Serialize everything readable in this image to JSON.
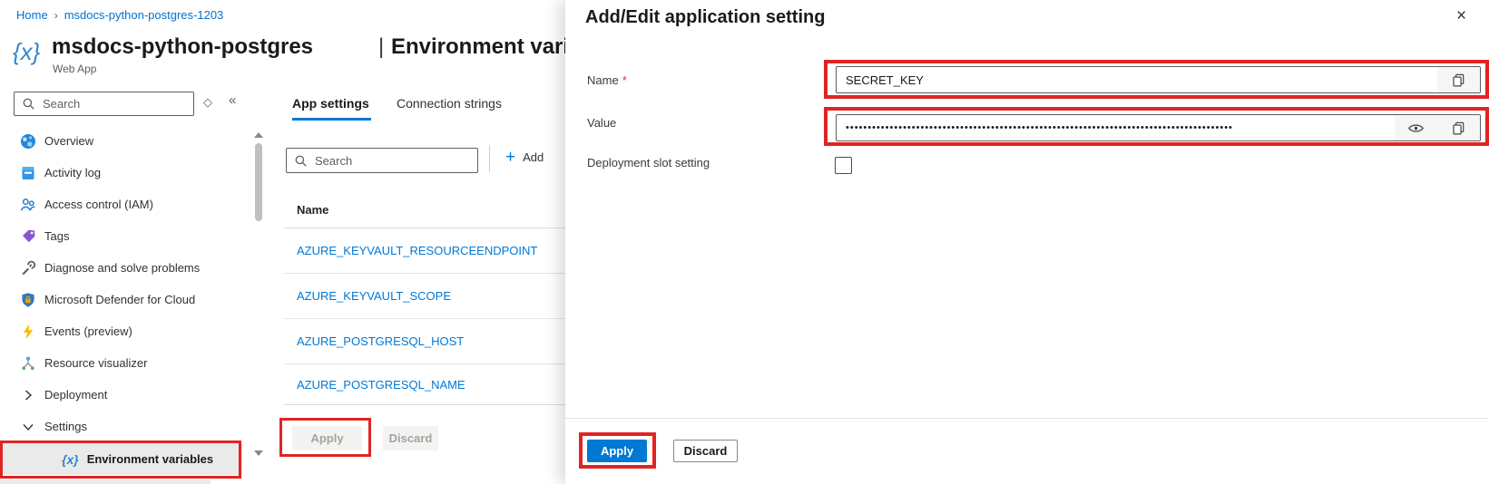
{
  "colors": {
    "accent": "#0078d4",
    "annotation_red": "#e02424",
    "link_blue": "#0072cf"
  },
  "breadcrumb": {
    "home": "Home",
    "separator": "›",
    "current": "msdocs-python-postgres-1203"
  },
  "header": {
    "app_icon": "{x}",
    "title": "msdocs-python-postgres",
    "subtitle": "Web App",
    "divider": "|",
    "blade": "Environment variables"
  },
  "sidebar": {
    "search_placeholder": "Search",
    "pin_icon": "◇",
    "collapse_icon": "«",
    "items": [
      {
        "label": "Overview"
      },
      {
        "label": "Activity log"
      },
      {
        "label": "Access control (IAM)"
      },
      {
        "label": "Tags"
      },
      {
        "label": "Diagnose and solve problems"
      },
      {
        "label": "Microsoft Defender for Cloud"
      },
      {
        "label": "Events (preview)"
      },
      {
        "label": "Resource visualizer"
      },
      {
        "label": "Deployment"
      },
      {
        "label": "Settings"
      }
    ],
    "selected_item": {
      "label": "Environment variables",
      "icon_glyph": "{x}"
    }
  },
  "main": {
    "tabs": {
      "app_settings": "App settings",
      "connection_strings": "Connection strings"
    },
    "search_placeholder": "Search",
    "add_icon": "+",
    "add_label": "Add",
    "table": {
      "name_header": "Name",
      "rows": [
        "AZURE_KEYVAULT_RESOURCEENDPOINT",
        "AZURE_KEYVAULT_SCOPE",
        "AZURE_POSTGRESQL_HOST",
        "AZURE_POSTGRESQL_NAME"
      ]
    },
    "apply_label": "Apply",
    "discard_label": "Discard"
  },
  "panel": {
    "title": "Add/Edit application setting",
    "close_icon": "×",
    "name_field": {
      "label": "Name",
      "required_marker": "*",
      "value": "SECRET_KEY"
    },
    "value_field": {
      "label": "Value",
      "masked_value": "••••••••••••••••••••••••••••••••••••••••••••••••••••••••••••••••••••••••••••••••••••••••"
    },
    "slot_field": {
      "label": "Deployment slot setting",
      "checked": false
    },
    "apply_label": "Apply",
    "discard_label": "Discard"
  }
}
